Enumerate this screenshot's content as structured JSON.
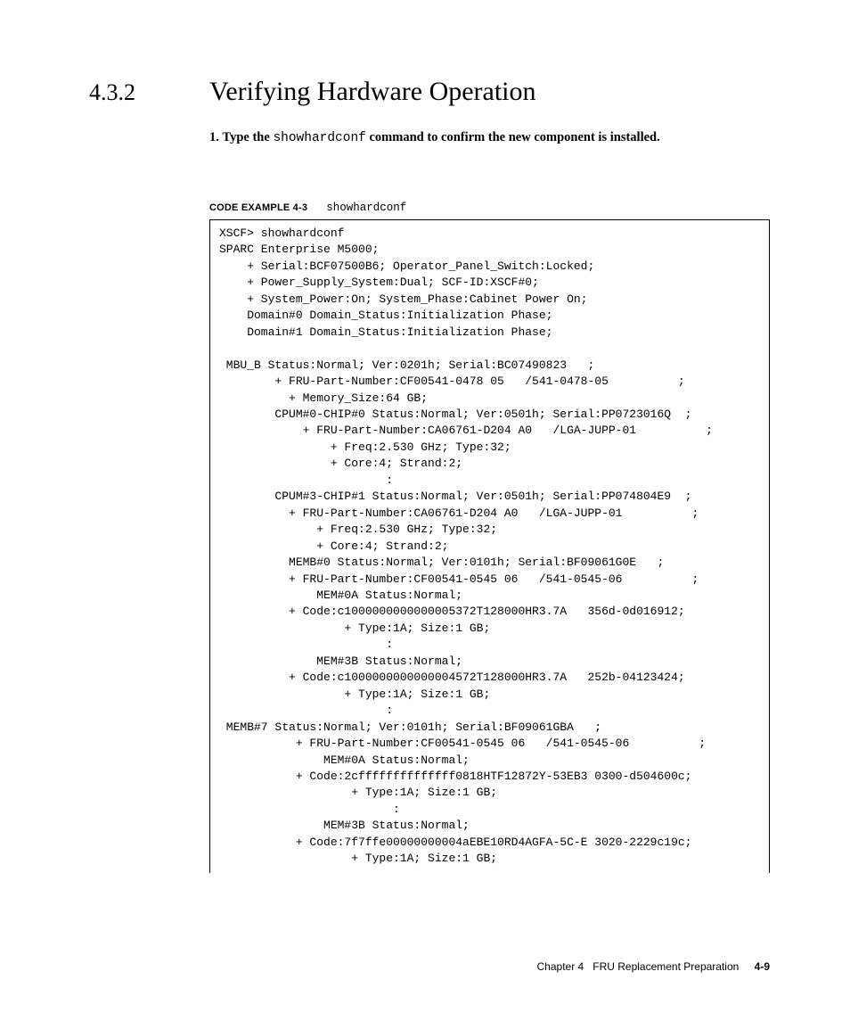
{
  "section": {
    "number": "4.3.2",
    "title": "Verifying Hardware Operation"
  },
  "step": {
    "num": "1.",
    "lead": "Type the ",
    "cmd": "showhardconf",
    "tail": " command to confirm the new component is installed."
  },
  "caption": {
    "label": "CODE EXAMPLE 4-3",
    "cmd": "showhardconf"
  },
  "code": "XSCF> showhardconf\nSPARC Enterprise M5000;\n    + Serial:BCF07500B6; Operator_Panel_Switch:Locked;\n    + Power_Supply_System:Dual; SCF-ID:XSCF#0;\n    + System_Power:On; System_Phase:Cabinet Power On;\n    Domain#0 Domain_Status:Initialization Phase;\n    Domain#1 Domain_Status:Initialization Phase;\n\n MBU_B Status:Normal; Ver:0201h; Serial:BC07490823   ;\n        + FRU-Part-Number:CF00541-0478 05   /541-0478-05          ;\n          + Memory_Size:64 GB;\n        CPUM#0-CHIP#0 Status:Normal; Ver:0501h; Serial:PP0723016Q  ;\n            + FRU-Part-Number:CA06761-D204 A0   /LGA-JUPP-01          ;\n                + Freq:2.530 GHz; Type:32;\n                + Core:4; Strand:2;\n                        :\n        CPUM#3-CHIP#1 Status:Normal; Ver:0501h; Serial:PP074804E9  ;\n          + FRU-Part-Number:CA06761-D204 A0   /LGA-JUPP-01          ;\n              + Freq:2.530 GHz; Type:32;\n              + Core:4; Strand:2;\n          MEMB#0 Status:Normal; Ver:0101h; Serial:BF09061G0E   ;\n          + FRU-Part-Number:CF00541-0545 06   /541-0545-06          ;\n              MEM#0A Status:Normal;\n          + Code:c1000000000000005372T128000HR3.7A   356d-0d016912;\n                  + Type:1A; Size:1 GB;\n                        :\n              MEM#3B Status:Normal;\n          + Code:c1000000000000004572T128000HR3.7A   252b-04123424;\n                  + Type:1A; Size:1 GB;\n                        :\n MEMB#7 Status:Normal; Ver:0101h; Serial:BF09061GBA   ;\n           + FRU-Part-Number:CF00541-0545 06   /541-0545-06          ;\n               MEM#0A Status:Normal;\n           + Code:2cffffffffffffff0818HTF12872Y-53EB3 0300-d504600c;\n                   + Type:1A; Size:1 GB;\n                         :\n               MEM#3B Status:Normal;\n           + Code:7f7ffe00000000004aEBE10RD4AGFA-5C-E 3020-2229c19c;\n                   + Type:1A; Size:1 GB;",
  "footer": {
    "chapter": "Chapter 4",
    "title": "FRU Replacement Preparation",
    "page": "4-9"
  }
}
